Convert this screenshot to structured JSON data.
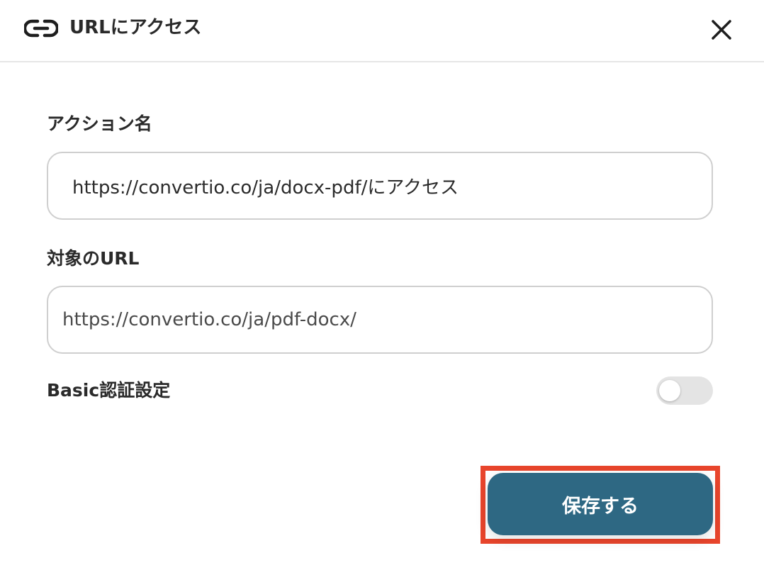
{
  "header": {
    "title": "URLにアクセス",
    "icon": "link-icon",
    "close_icon": "close-icon"
  },
  "form": {
    "action_name": {
      "label": "アクション名",
      "value": "https://convertio.co/ja/docx-pdf/にアクセス"
    },
    "target_url": {
      "label": "対象のURL",
      "value": "https://convertio.co/ja/pdf-docx/"
    },
    "basic_auth": {
      "label": "Basic認証設定",
      "enabled": false
    }
  },
  "footer": {
    "save_label": "保存する"
  },
  "colors": {
    "primary": "#2e6883",
    "highlight": "#e8452c",
    "toggle_off": "#e4e4e4",
    "border": "#cfcfcf"
  }
}
